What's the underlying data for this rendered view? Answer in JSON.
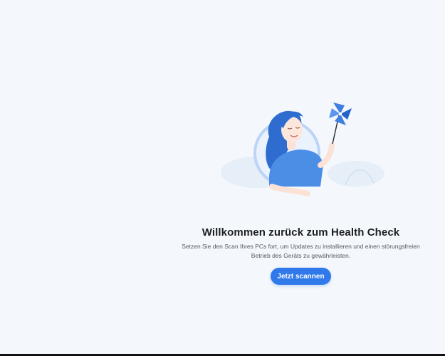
{
  "welcome": {
    "title": "Willkommen zurück zum Health Check",
    "description_line1": "Setzen Sie den Scan Ihres PCs fort, um Updates zu installieren und einen störungsfreien",
    "description_line2": "Betrieb des Geräts zu gewährleisten.",
    "scan_button_label": "Jetzt scannen"
  },
  "colors": {
    "background": "#f4f8fc",
    "accent": "#2f79ea",
    "title_text": "#1d1d1f",
    "body_text": "#555a61"
  },
  "icons": {
    "illustration": "woman-with-pinwheel-illustration"
  }
}
